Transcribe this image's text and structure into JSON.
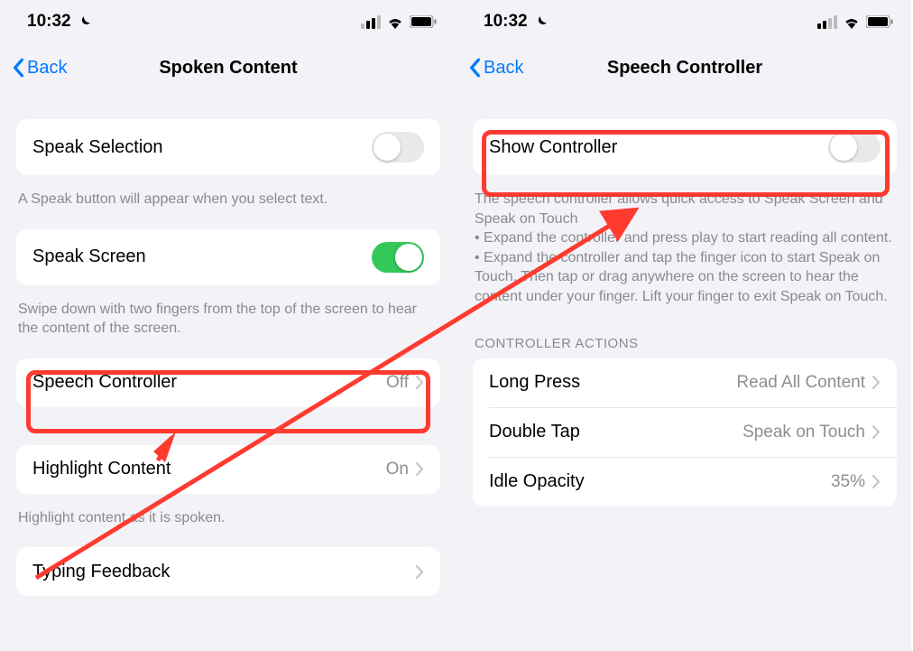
{
  "status": {
    "time": "10:32",
    "signal_strength": 2
  },
  "left": {
    "back_label": "Back",
    "title": "Spoken Content",
    "speak_selection": {
      "label": "Speak Selection",
      "on": false
    },
    "speak_selection_footer": "A Speak button will appear when you select text.",
    "speak_screen": {
      "label": "Speak Screen",
      "on": true
    },
    "speak_screen_footer": "Swipe down with two fingers from the top of the screen to hear the content of the screen.",
    "speech_controller": {
      "label": "Speech Controller",
      "value": "Off"
    },
    "highlight_content": {
      "label": "Highlight Content",
      "value": "On"
    },
    "highlight_footer": "Highlight content as it is spoken.",
    "typing_feedback": {
      "label": "Typing Feedback"
    }
  },
  "right": {
    "back_label": "Back",
    "title": "Speech Controller",
    "show_controller": {
      "label": "Show Controller",
      "on": false
    },
    "show_controller_footer": "The speech controller allows quick access to Speak Screen and Speak on Touch\n • Expand the controller and press play to start reading all content.\n • Expand the controller and tap the finger icon to start Speak on Touch. Then tap or drag anywhere on the screen to hear the content under your finger. Lift your finger to exit Speak on Touch.",
    "actions_header": "Controller Actions",
    "actions": [
      {
        "label": "Long Press",
        "value": "Read All Content"
      },
      {
        "label": "Double Tap",
        "value": "Speak on Touch"
      },
      {
        "label": "Idle Opacity",
        "value": "35%"
      }
    ]
  }
}
